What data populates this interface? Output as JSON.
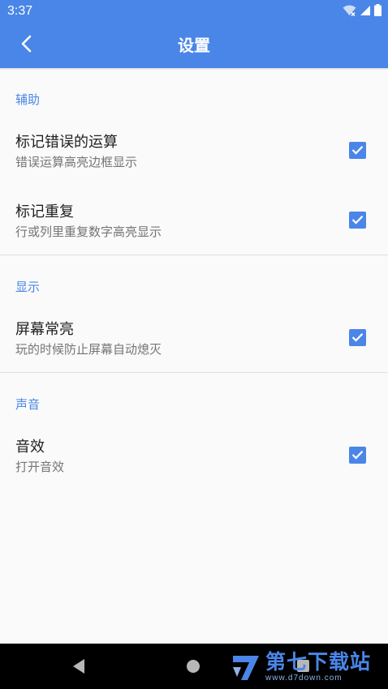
{
  "status_bar": {
    "time": "3:37"
  },
  "app_bar": {
    "title": "设置"
  },
  "sections": [
    {
      "header": "辅助",
      "items": [
        {
          "title": "标记错误的运算",
          "summary": "错误运算高亮边框显示",
          "checked": true
        },
        {
          "title": "标记重复",
          "summary": "行或列里重复数字高亮显示",
          "checked": true
        }
      ]
    },
    {
      "header": "显示",
      "items": [
        {
          "title": "屏幕常亮",
          "summary": "玩的时候防止屏幕自动熄灭",
          "checked": true
        }
      ]
    },
    {
      "header": "声音",
      "items": [
        {
          "title": "音效",
          "summary": "打开音效",
          "checked": true
        }
      ]
    }
  ],
  "watermark": {
    "name": "第七下载站",
    "url": "www.d7down.com"
  },
  "colors": {
    "accent": "#4a86e8",
    "background": "#fafafa",
    "nav_bar": "#000000"
  }
}
